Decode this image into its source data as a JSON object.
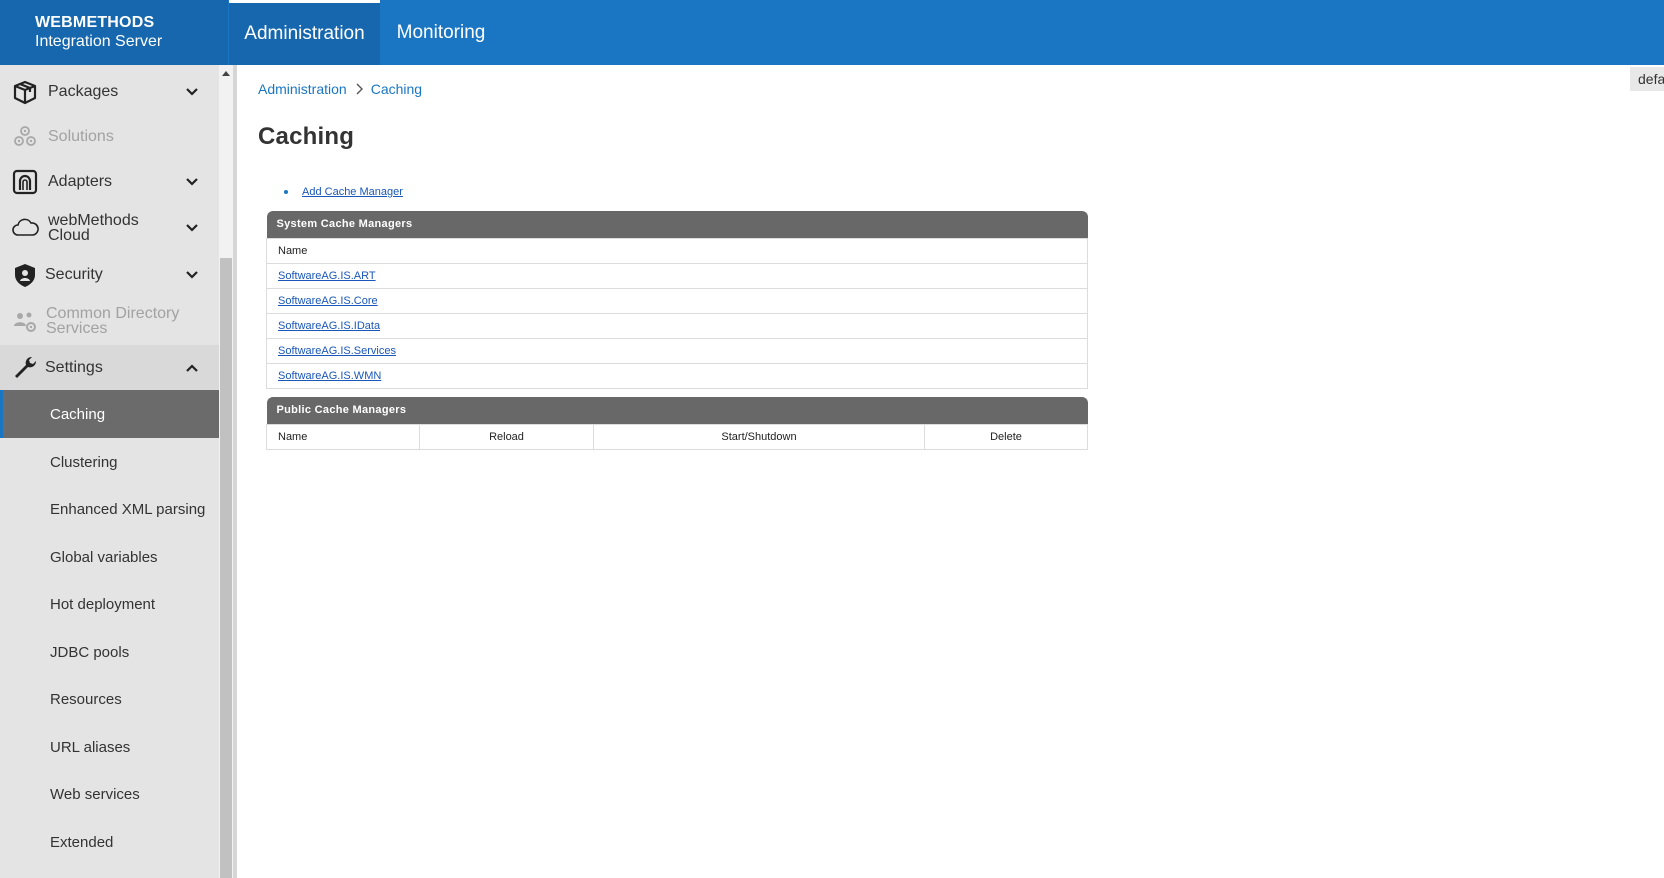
{
  "brand": {
    "line1": "WEBMETHODS",
    "line2": "Integration Server"
  },
  "top_tabs": [
    {
      "label": "Administration",
      "active": true
    },
    {
      "label": "Monitoring",
      "active": false
    }
  ],
  "sidebar": {
    "items": [
      {
        "label": "Packages",
        "icon": "package-icon",
        "expandable": true,
        "disabled": false
      },
      {
        "label": "Solutions",
        "icon": "solutions-icon",
        "expandable": false,
        "disabled": true
      },
      {
        "label": "Adapters",
        "icon": "adapter-icon",
        "expandable": true,
        "disabled": false
      },
      {
        "label": "webMethods Cloud",
        "line1": "webMethods",
        "line2": "Cloud",
        "icon": "cloud-icon",
        "expandable": true,
        "disabled": false
      },
      {
        "label": "Security",
        "icon": "shield-icon",
        "expandable": true,
        "disabled": false
      },
      {
        "label": "Common Directory Services",
        "line1": "Common Directory",
        "line2": "Services",
        "icon": "users-icon",
        "expandable": false,
        "disabled": true
      },
      {
        "label": "Settings",
        "icon": "wrench-icon",
        "expandable": true,
        "expanded": true,
        "disabled": false
      }
    ],
    "settings_children": [
      {
        "label": "Caching",
        "active": true
      },
      {
        "label": "Clustering"
      },
      {
        "label": "Enhanced XML parsing"
      },
      {
        "label": "Global variables"
      },
      {
        "label": "Hot deployment"
      },
      {
        "label": "JDBC pools"
      },
      {
        "label": "Resources"
      },
      {
        "label": "URL aliases"
      },
      {
        "label": "Web services"
      },
      {
        "label": "Extended"
      }
    ]
  },
  "breadcrumb": {
    "root": "Administration",
    "current": "Caching"
  },
  "page_title": "Caching",
  "corner_tag": "defa",
  "actions": {
    "add_cache_manager": "Add Cache Manager"
  },
  "system_cache_managers": {
    "title": "System Cache Managers",
    "column": "Name",
    "rows": [
      "SoftwareAG.IS.ART",
      "SoftwareAG.IS.Core",
      "SoftwareAG.IS.IData",
      "SoftwareAG.IS.Services",
      "SoftwareAG.IS.WMN"
    ]
  },
  "public_cache_managers": {
    "title": "Public Cache Managers",
    "columns": [
      "Name",
      "Reload",
      "Start/Shutdown",
      "Delete"
    ]
  },
  "colors": {
    "header_blue": "#1a76c2",
    "brand_blue": "#1667ad",
    "table_header": "#686868",
    "active_nav": "#6b6b6b"
  }
}
